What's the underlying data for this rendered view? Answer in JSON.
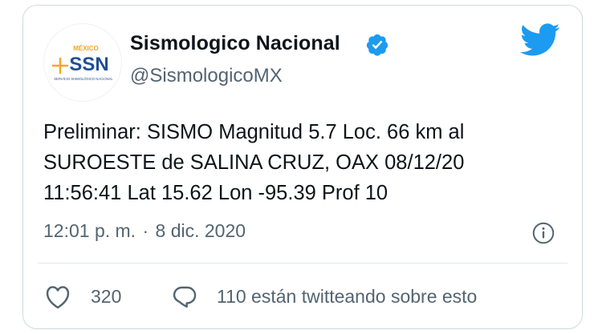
{
  "tweet": {
    "author": {
      "display_name": "Sismologico Nacional",
      "handle": "@SismologicoMX",
      "verified": true,
      "avatar_icon": "ssn-logo",
      "avatar_logo": {
        "top_text": "MÉXICO",
        "main_text": "SSN",
        "bottom_text": "SERVICIO SISMOLÓGICO NACIONAL"
      }
    },
    "brand_icon": "twitter-bird-icon",
    "text": "Preliminar: SISMO Magnitud 5.7 Loc. 66 km al\nSUROESTE de SALINA CRUZ, OAX 08/12/20\n11:56:41 Lat 15.62 Lon -95.39 Prof 10",
    "time": "12:01 p. m.",
    "separator": "·",
    "date": "8 dic. 2020",
    "likes": "320",
    "conversation": "110 están twitteando sobre esto"
  },
  "colors": {
    "text_primary": "#0f1419",
    "text_secondary": "#536471",
    "twitter_blue": "#1d9bf0",
    "border": "#cfd9de",
    "logo_blue": "#1f4e96",
    "logo_orange": "#f5a623"
  }
}
